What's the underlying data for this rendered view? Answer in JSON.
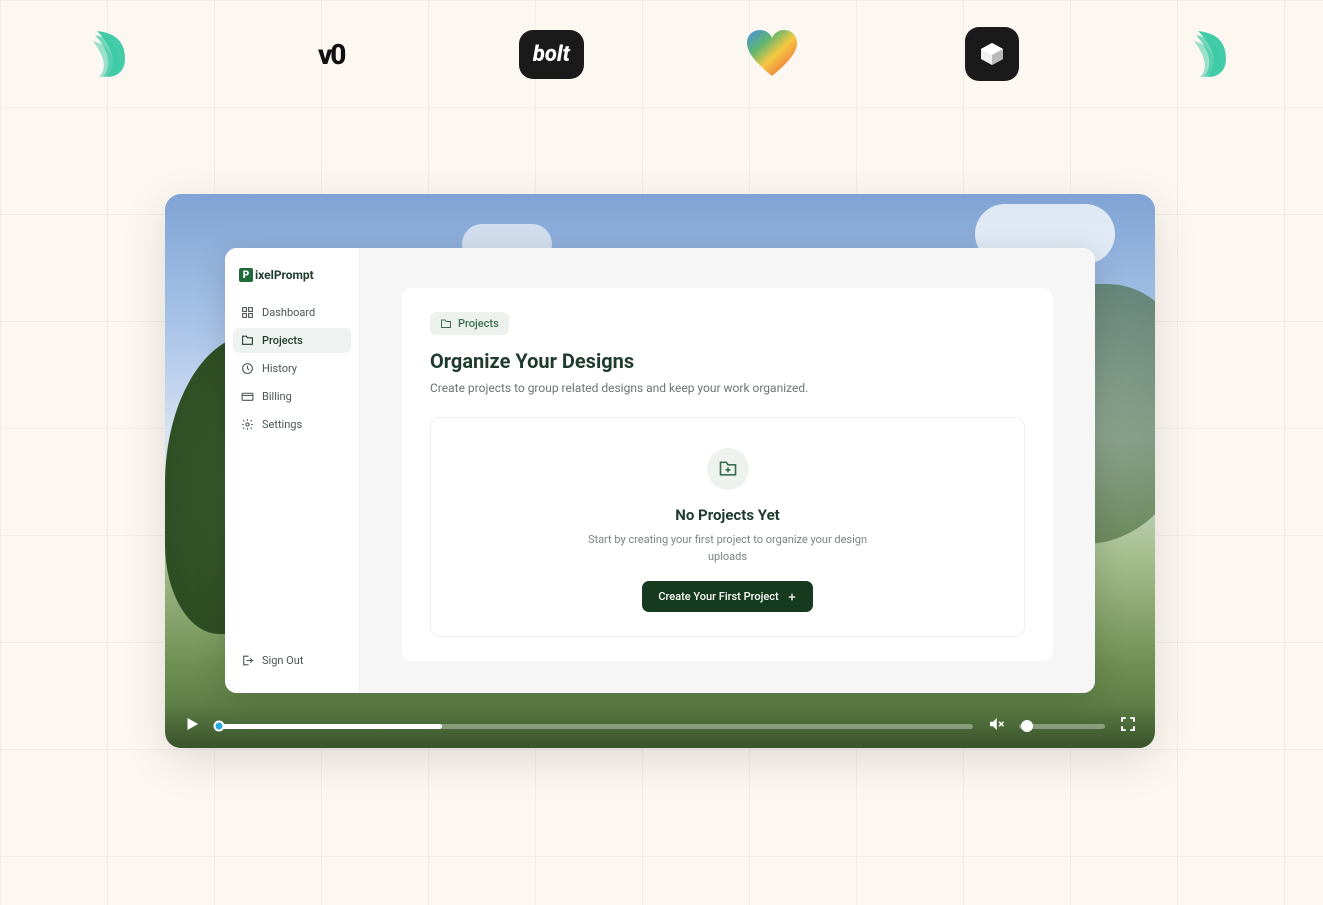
{
  "logos": [
    "feather",
    "v0",
    "bolt",
    "lovable",
    "spline",
    "feather"
  ],
  "app": {
    "brand": "ixelPrompt",
    "sidebar": {
      "items": [
        {
          "label": "Dashboard"
        },
        {
          "label": "Projects"
        },
        {
          "label": "History"
        },
        {
          "label": "Billing"
        },
        {
          "label": "Settings"
        }
      ],
      "signout": "Sign Out"
    },
    "breadcrumb": "Projects",
    "title": "Organize Your Designs",
    "subtitle": "Create projects to group related designs and keep your work organized.",
    "empty": {
      "title": "No Projects Yet",
      "text": "Start by creating your first project to organize your design uploads",
      "cta": "Create Your First Project"
    }
  },
  "video": {
    "progress_percent": 30,
    "play_position_percent": 1,
    "volume_percent": 8
  }
}
